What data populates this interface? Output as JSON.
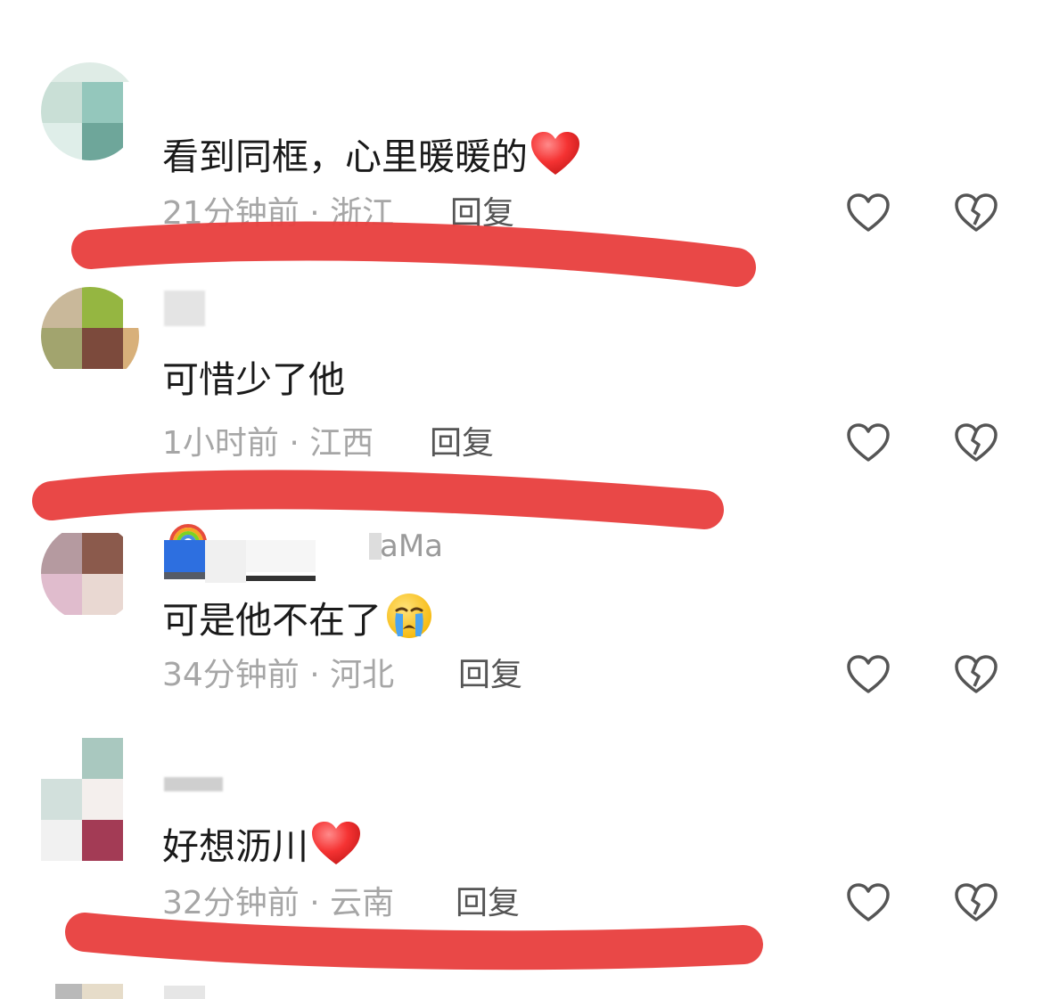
{
  "accent_red": "#e8413f",
  "comments": [
    {
      "text": "看到同框，心里暖暖的",
      "emoji": "red-heart",
      "time": "21分钟前",
      "location": "浙江",
      "reply_label": "回复"
    },
    {
      "text": "可惜少了他",
      "time": "1小时前",
      "location": "江西",
      "reply_label": "回复"
    },
    {
      "username_fragment": "aMa",
      "text": "可是他不在了",
      "emoji": "crying-face",
      "time": "34分钟前",
      "location": "河北",
      "reply_label": "回复"
    },
    {
      "text": "好想沥川",
      "emoji": "red-heart",
      "time": "32分钟前",
      "location": "云南",
      "reply_label": "回复"
    }
  ],
  "separator": "·",
  "icons": [
    "heart-outline-icon",
    "broken-heart-icon"
  ]
}
